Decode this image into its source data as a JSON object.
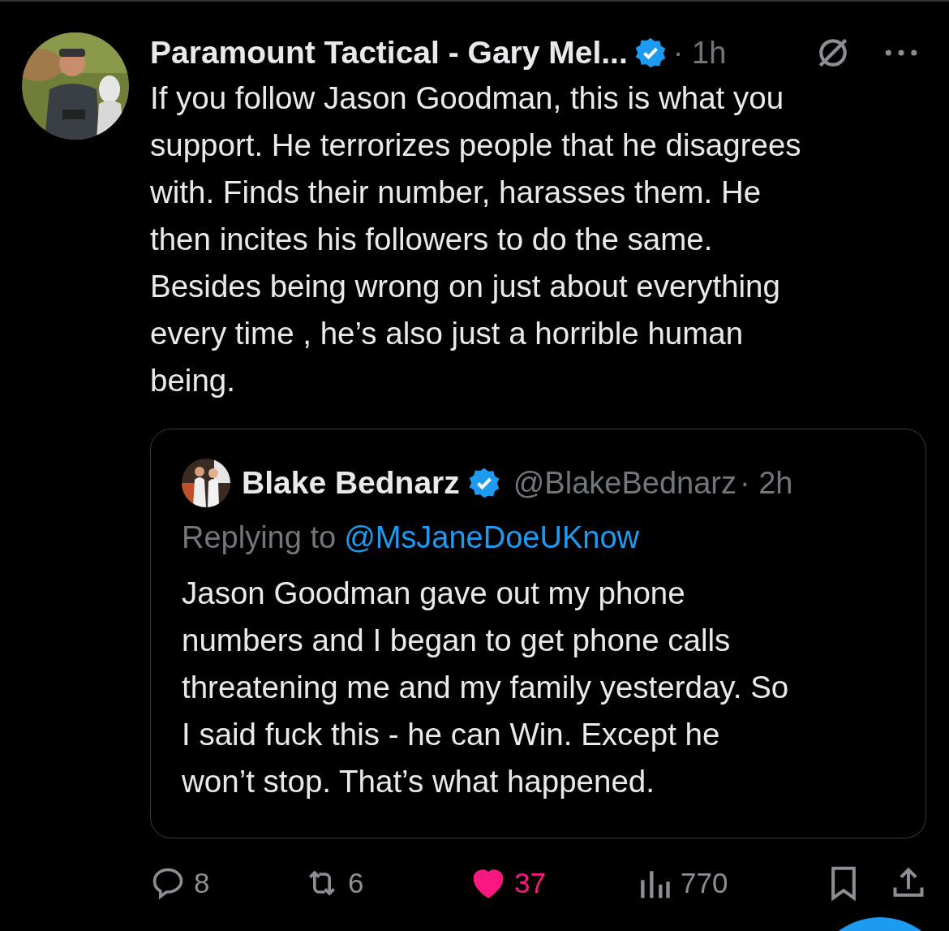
{
  "post": {
    "author": "Paramount Tactical - Gary Mel...",
    "verified": true,
    "time": "· 1h",
    "text": "If you follow Jason Goodman, this is what you\nsupport. He terrorizes people that he disagrees\nwith. Finds their number, harasses them. He\nthen incites his followers to do the same.\nBesides being wrong on just about everything\nevery time , he’s also just a horrible human\nbeing."
  },
  "quoted": {
    "author": "Blake Bednarz",
    "verified": true,
    "handle": "@BlakeBednarz",
    "time": "· 2h",
    "replying_label": "Replying to",
    "replying_to": "@MsJaneDoeUKnow",
    "text": "Jason Goodman gave out my phone\nnumbers and I began to get phone calls\nthreatening me and my family yesterday. So\nI said fuck this - he can Win. Except he\nwon’t stop. That’s what happened."
  },
  "actions": {
    "replies": "8",
    "reposts": "6",
    "likes": "37",
    "liked": true,
    "views": "770"
  }
}
